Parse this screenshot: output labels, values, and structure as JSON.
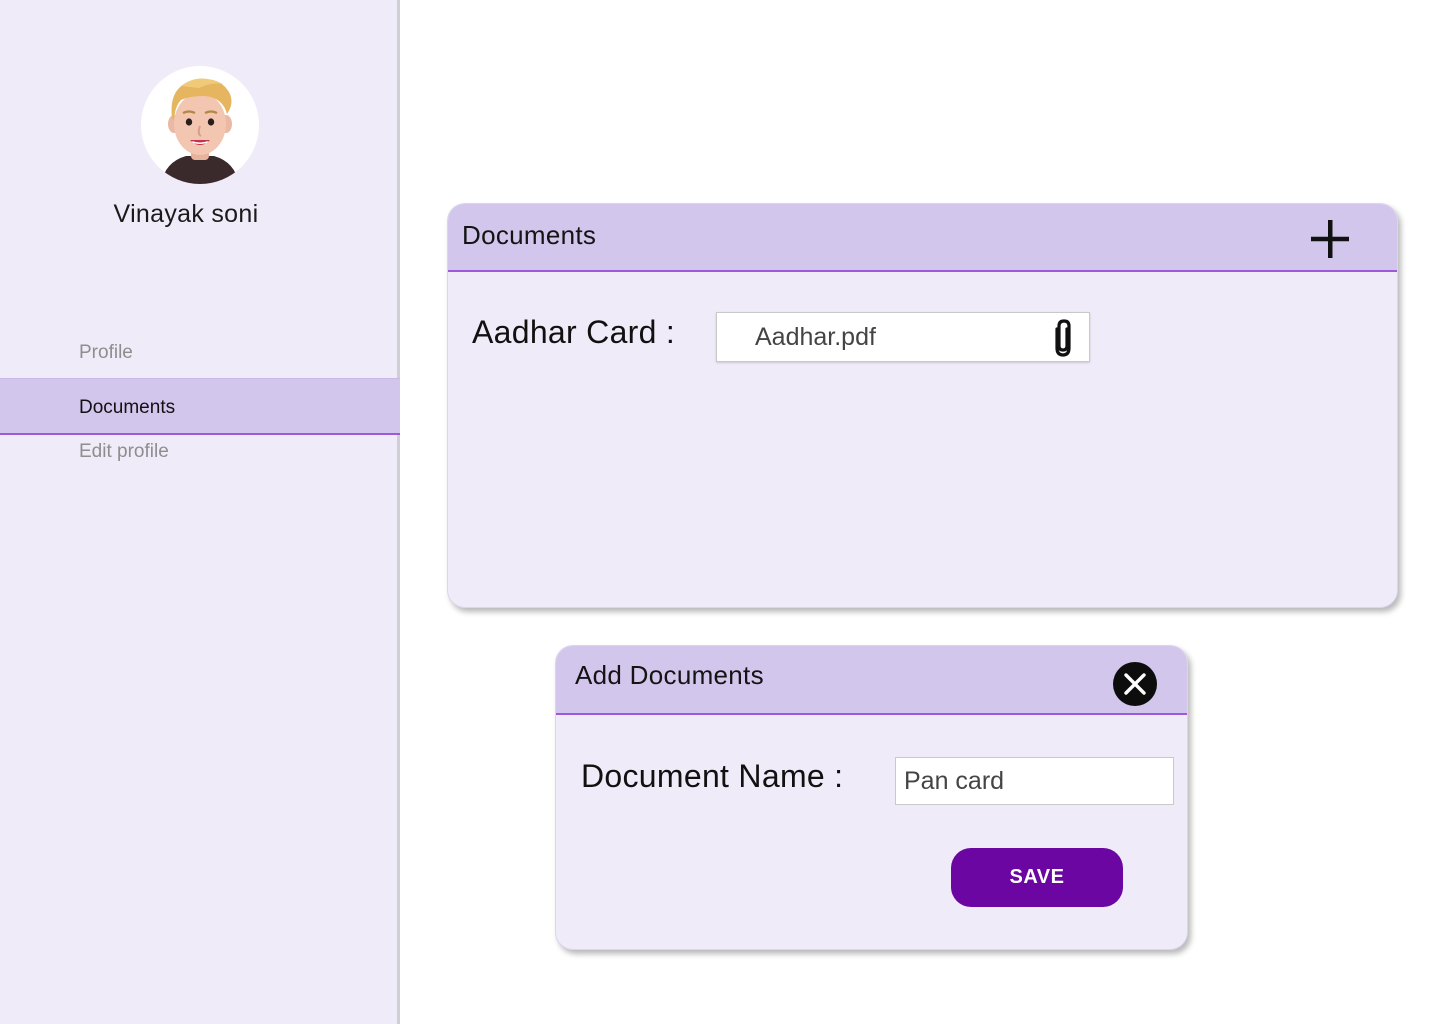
{
  "sidebar": {
    "user_name": "Vinayak soni",
    "nav": [
      {
        "label": "Profile",
        "active": false
      },
      {
        "label": "Documents",
        "active": true
      },
      {
        "label": "Edit  profile",
        "active": false
      }
    ]
  },
  "documents_card": {
    "title": "Documents",
    "add_icon": "plus-icon",
    "rows": [
      {
        "label": "Aadhar Card :",
        "file_name": "Aadhar.pdf",
        "icon": "paperclip-icon"
      }
    ]
  },
  "add_documents_modal": {
    "title": "Add Documents",
    "close_icon": "close-icon",
    "field_label": "Document Name :",
    "field_value": "Pan card",
    "save_label": "SAVE"
  },
  "colors": {
    "sidebar_bg": "#efebf8",
    "header_bg": "#d3c6ec",
    "accent_line": "#9b5ad8",
    "save_button": "#6c06a3"
  }
}
